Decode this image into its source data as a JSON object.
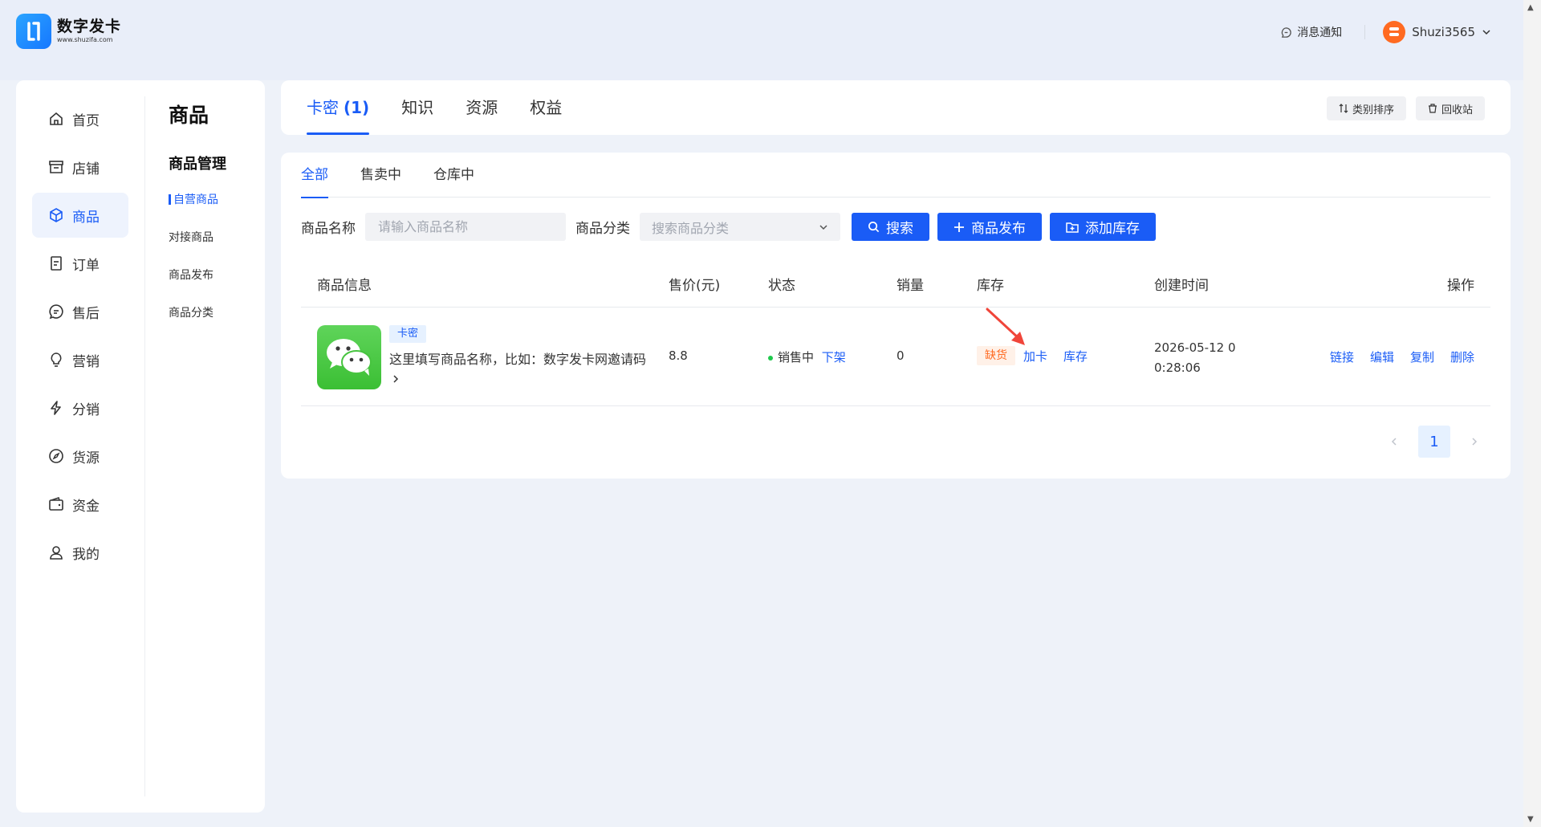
{
  "brand": {
    "name": "数字发卡",
    "url": "www.shuzifa.com"
  },
  "header": {
    "notice": "消息通知",
    "username": "Shuzi3565"
  },
  "sidebar": {
    "items": [
      {
        "label": "首页",
        "icon": "home-icon"
      },
      {
        "label": "店铺",
        "icon": "store-icon"
      },
      {
        "label": "商品",
        "icon": "cube-icon",
        "active": true
      },
      {
        "label": "订单",
        "icon": "document-icon"
      },
      {
        "label": "售后",
        "icon": "chat-icon"
      },
      {
        "label": "营销",
        "icon": "bulb-icon"
      },
      {
        "label": "分销",
        "icon": "lightning-icon"
      },
      {
        "label": "货源",
        "icon": "compass-icon"
      },
      {
        "label": "资金",
        "icon": "wallet-icon"
      },
      {
        "label": "我的",
        "icon": "user-icon"
      }
    ],
    "sub_title": "商品",
    "sub_group": "商品管理",
    "sub_items": [
      "自营商品",
      "对接商品",
      "商品发布",
      "商品分类"
    ]
  },
  "category_tabs": [
    {
      "label": "卡密",
      "count": "(1)",
      "active": true
    },
    {
      "label": "知识",
      "count": ""
    },
    {
      "label": "资源",
      "count": ""
    },
    {
      "label": "权益",
      "count": ""
    }
  ],
  "top_buttons": {
    "sort": "类别排序",
    "recycle": "回收站"
  },
  "status_tabs": [
    "全部",
    "售卖中",
    "仓库中"
  ],
  "filters": {
    "name_label": "商品名称",
    "name_placeholder": "请输入商品名称",
    "category_label": "商品分类",
    "category_placeholder": "搜索商品分类",
    "search": "搜索",
    "publish": "商品发布",
    "add_stock": "添加库存"
  },
  "table": {
    "columns": [
      "商品信息",
      "售价(元)",
      "状态",
      "销量",
      "库存",
      "创建时间",
      "操作"
    ],
    "rows": [
      {
        "tag": "卡密",
        "name": "这里填写商品名称，比如：数字发卡网邀请码",
        "price": "8.8",
        "status": "销售中",
        "status_action": "下架",
        "sales": "0",
        "stock_tag": "缺货",
        "stock_actions": [
          "加卡",
          "库存"
        ],
        "created": "2026-05-12 0\n0:28:06",
        "actions": [
          "链接",
          "编辑",
          "复制",
          "删除"
        ]
      }
    ]
  },
  "pagination": {
    "current": "1"
  },
  "colors": {
    "primary": "#1a5cf6",
    "warning": "#ff6a21",
    "success": "#1ec94c",
    "annotation_arrow": "#f0453a"
  }
}
